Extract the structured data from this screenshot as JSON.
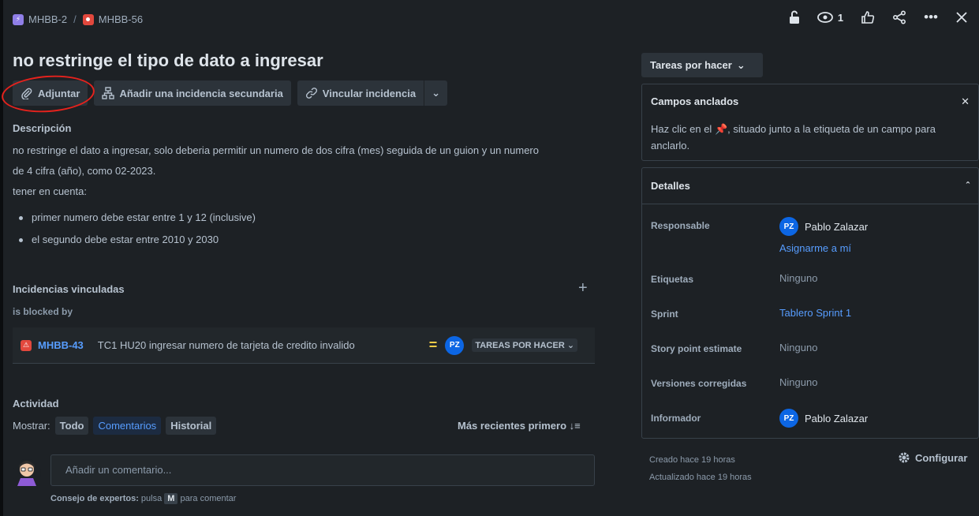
{
  "breadcrumb": {
    "parent_key": "MHBB-2",
    "separator": "/",
    "issue_key": "MHBB-56"
  },
  "top_actions": {
    "watch_count": "1"
  },
  "issue": {
    "title": "no restringe el tipo de dato a ingresar"
  },
  "actions": {
    "attach": "Adjuntar",
    "add_child": "Añadir una incidencia secundaria",
    "link_issue": "Vincular incidencia"
  },
  "description": {
    "heading": "Descripción",
    "line1": "no restringe el dato a ingresar, solo deberia permitir un numero de dos cifra (mes) seguida de un guion y un numero",
    "line2": "de 4 cifra (año), como 02-2023.",
    "line3": "tener en cuenta:",
    "bullets": [
      "primer numero debe estar entre 1 y 12 (inclusive)",
      "el segundo debe estar entre 2010 y 2030"
    ]
  },
  "linked_issues": {
    "heading": "Incidencias vinculadas",
    "relation": "is blocked by",
    "item": {
      "key": "MHBB-43",
      "summary": "TC1 HU20 ingresar numero de tarjeta de credito invalido",
      "priority_symbol": "=",
      "assignee_initials": "PZ",
      "status": "TAREAS POR HACER"
    }
  },
  "activity": {
    "heading": "Actividad",
    "show_label": "Mostrar:",
    "filters": [
      "Todo",
      "Comentarios",
      "Historial"
    ],
    "active_filter": "Comentarios",
    "sort_label": "Más recientes primero",
    "comment_placeholder": "Añadir un comentario...",
    "tip_bold": "Consejo de expertos:",
    "tip_text_1": "pulsa",
    "tip_key": "M",
    "tip_text_2": "para comentar"
  },
  "sidebar": {
    "status_button": "Tareas por hacer",
    "pinned": {
      "title": "Campos anclados",
      "text_before": "Haz clic en el",
      "text_after": ", situado junto a la etiqueta de un campo para anclarlo."
    },
    "details": {
      "title": "Detalles",
      "rows": {
        "assignee_label": "Responsable",
        "assignee_initials": "PZ",
        "assignee_name": "Pablo Zalazar",
        "assign_me": "Asignarme a mí",
        "labels_label": "Etiquetas",
        "labels_value": "Ninguno",
        "sprint_label": "Sprint",
        "sprint_value": "Tablero Sprint 1",
        "story_points_label": "Story point estimate",
        "story_points_value": "Ninguno",
        "fix_versions_label": "Versiones corregidas",
        "fix_versions_value": "Ninguno",
        "reporter_label": "Informador",
        "reporter_initials": "PZ",
        "reporter_name": "Pablo Zalazar"
      }
    },
    "created": "Creado hace 19 horas",
    "updated": "Actualizado hace 19 horas",
    "configure": "Configurar"
  },
  "colors": {
    "background": "#1d2125",
    "link": "#579dff",
    "annotation": "#e5221d",
    "priority": "#f5cd47"
  }
}
